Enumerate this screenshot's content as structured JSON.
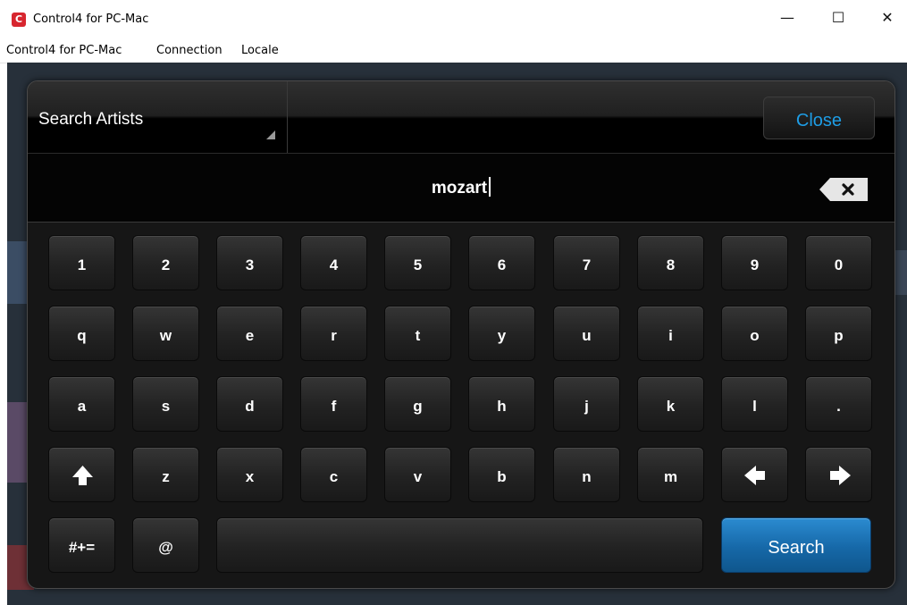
{
  "window": {
    "title": "Control4 for PC-Mac",
    "icon_glyph": "C",
    "minimize_glyph": "—",
    "maximize_glyph": "☐",
    "close_glyph": "✕"
  },
  "menu": [
    "Control4 for PC-Mac",
    "Connection",
    "Locale"
  ],
  "search": {
    "type_label": "Search Artists",
    "close_label": "Close",
    "query": "mozart",
    "backspace_icon": "backspace-icon"
  },
  "keyboard": {
    "rows": [
      [
        "1",
        "2",
        "3",
        "4",
        "5",
        "6",
        "7",
        "8",
        "9",
        "0"
      ],
      [
        "q",
        "w",
        "e",
        "r",
        "t",
        "y",
        "u",
        "i",
        "o",
        "p"
      ],
      [
        "a",
        "s",
        "d",
        "f",
        "g",
        "h",
        "j",
        "k",
        "l",
        "."
      ],
      [
        "shift-icon",
        "z",
        "x",
        "c",
        "v",
        "b",
        "n",
        "m",
        "arrow-left-icon",
        "arrow-right-icon"
      ]
    ],
    "symbols_label": "#+=",
    "at_label": "@",
    "search_label": "Search"
  },
  "colors": {
    "accent_blue": "#1e9de5",
    "search_button": "#1668a8",
    "brand_red": "#d7262f"
  }
}
